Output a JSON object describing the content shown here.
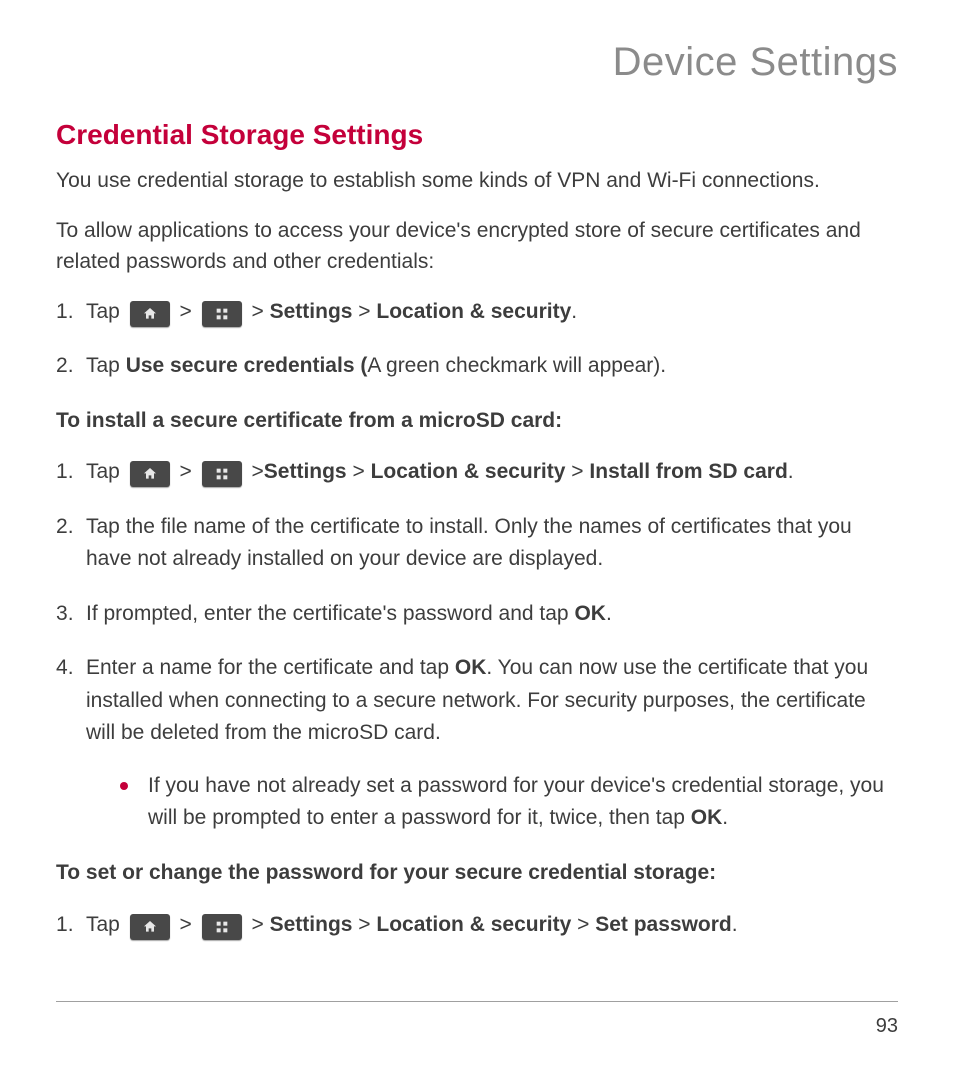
{
  "chapter": "Device Settings",
  "section": "Credential Storage Settings",
  "intro1": "You use credential storage to establish some kinds of VPN and Wi-Fi connections.",
  "intro2": "To allow applications to access your device's encrypted store of secure certificates and related passwords and other credentials:",
  "listA": {
    "item1_pre": "Tap ",
    "item1_sep1": " > ",
    "item1_sep2": " > ",
    "item1_settings": "Settings",
    "item1_gt": " > ",
    "item1_loc": "Location & security",
    "item1_end": ".",
    "item2_pre": "Tap ",
    "item2_bold": "Use secure credentials (",
    "item2_post": "A green checkmark will appear)."
  },
  "subhead1": "To install a secure certificate from a microSD card:",
  "listB": {
    "b1_pre": "Tap ",
    "b1_sep1": " > ",
    "b1_sep2": " >",
    "b1_settings": "Settings",
    "b1_gt1": " > ",
    "b1_loc": "Location & security",
    "b1_gt2": " > ",
    "b1_install": "Install from SD card",
    "b1_end": ".",
    "b2": "Tap the file name of the certificate to install. Only the names of certificates that you have not already installed on your device are displayed.",
    "b3_pre": "If prompted, enter the certificate's password and tap ",
    "b3_ok": "OK",
    "b3_end": ".",
    "b4_pre": "Enter a name for the certificate and tap ",
    "b4_ok": "OK",
    "b4_post": ". You can now use the certificate that you installed when connecting to a secure network. For security purposes, the certificate will be deleted from the microSD card."
  },
  "bullet": {
    "pre": "If you have not already set a password for your device's credential storage, you will be prompted to enter a password for it, twice, then tap ",
    "ok": "OK",
    "end": "."
  },
  "subhead2": "To set or change the password for your secure credential storage:",
  "listC": {
    "c1_pre": "Tap ",
    "c1_sep1": " > ",
    "c1_sep2": " > ",
    "c1_settings": "Settings",
    "c1_gt1": " > ",
    "c1_loc": "Location & security",
    "c1_gt2": " > ",
    "c1_setpw": "Set password",
    "c1_end": "."
  },
  "pageNumber": "93"
}
